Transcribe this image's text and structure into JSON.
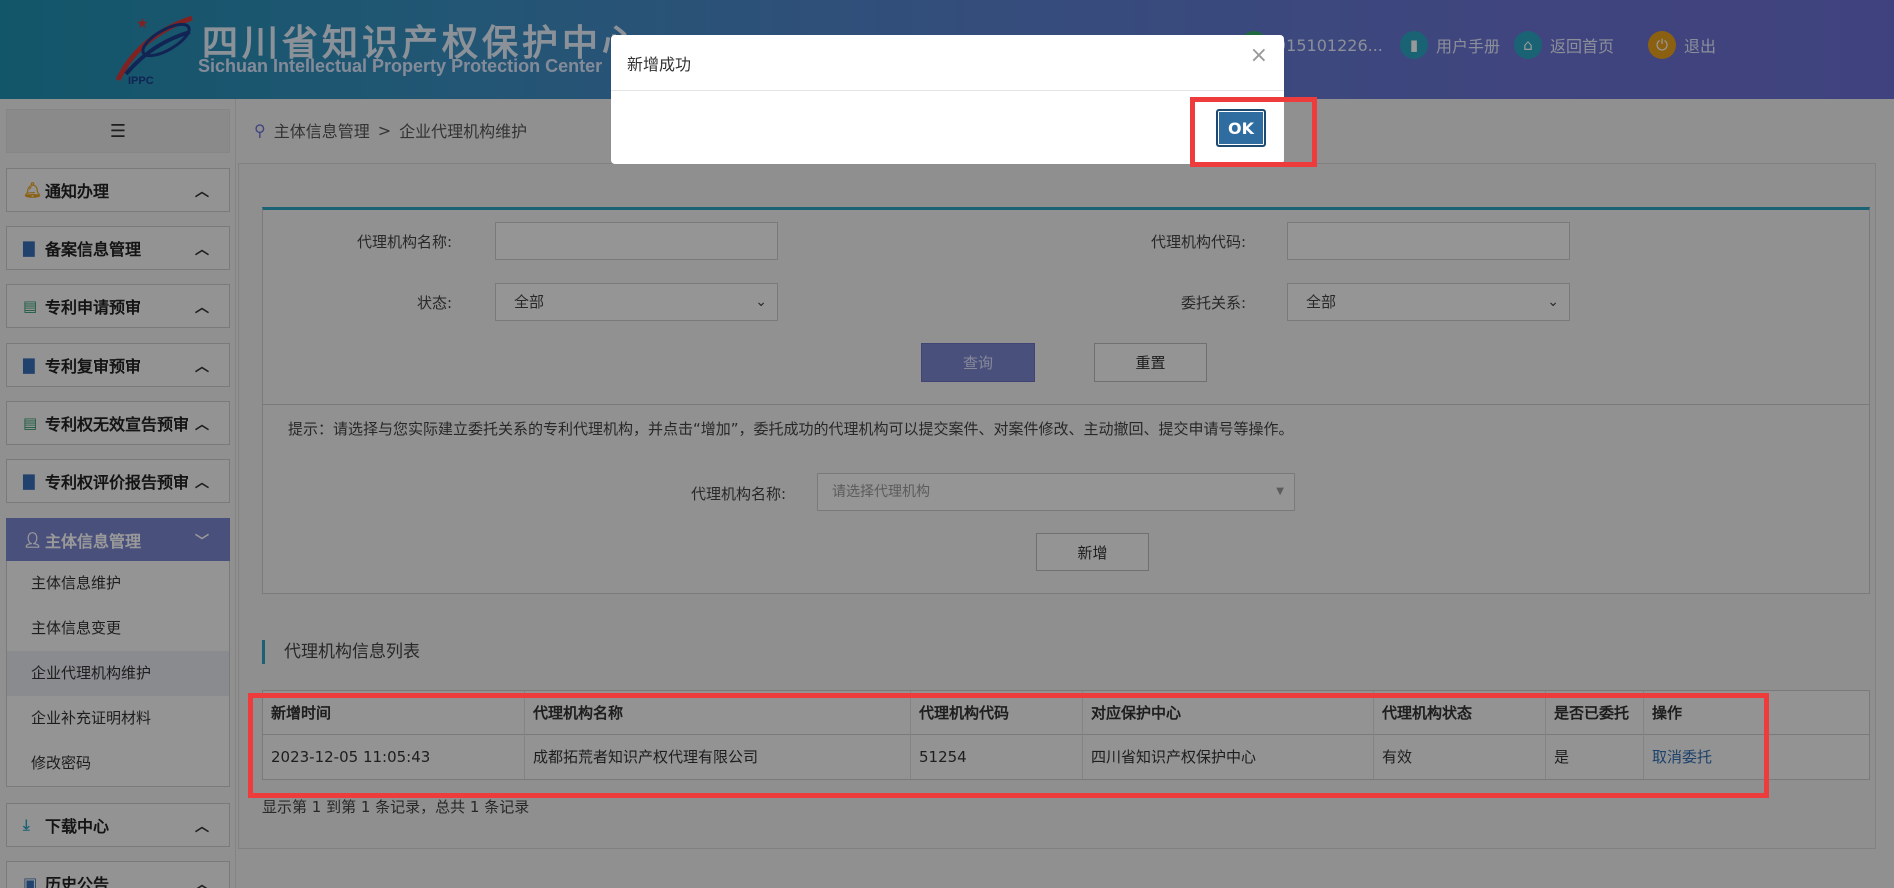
{
  "header": {
    "brand_cn": "四川省知识产权保护中心",
    "brand_en": "Sichuan Intellectual Property Protection Center",
    "logo_text": "IPPC",
    "account": "915101226...",
    "manual": "用户手册",
    "home": "返回首页",
    "logout": "退出"
  },
  "sidebar": {
    "groups": [
      {
        "label": "通知办理",
        "icon": "bell-icon"
      },
      {
        "label": "备案信息管理",
        "icon": "folder-icon"
      },
      {
        "label": "专利申请预审",
        "icon": "document-icon"
      },
      {
        "label": "专利复审预审",
        "icon": "folder-icon"
      },
      {
        "label": "专利权无效宣告预审",
        "icon": "document-icon"
      },
      {
        "label": "专利权评价报告预审",
        "icon": "folder-icon"
      },
      {
        "label": "主体信息管理",
        "icon": "user-icon"
      },
      {
        "label": "下载中心",
        "icon": "download-icon"
      },
      {
        "label": "历史公告",
        "icon": "announcement-icon"
      }
    ],
    "subitems": [
      "主体信息维护",
      "主体信息变更",
      "企业代理机构维护",
      "企业补充证明材料",
      "修改密码"
    ]
  },
  "breadcrumb": {
    "root": "主体信息管理",
    "sep": ">",
    "current": "企业代理机构维护"
  },
  "filter": {
    "name_label": "代理机构名称:",
    "code_label": "代理机构代码:",
    "status_label": "状态:",
    "status_value": "全部",
    "relation_label": "委托关系:",
    "relation_value": "全部",
    "query_button": "查询",
    "reset_button": "重置",
    "tip": "提示：请选择与您实际建立委托关系的专利代理机构，并点击“增加”，委托成功的代理机构可以提交案件、对案件修改、主动撤回、提交申请号等操作。",
    "agency_label": "代理机构名称:",
    "agency_placeholder": "请选择代理机构",
    "add_button": "新增"
  },
  "list": {
    "title": "代理机构信息列表",
    "columns": [
      "新增时间",
      "代理机构名称",
      "代理机构代码",
      "对应保护中心",
      "代理机构状态",
      "是否已委托",
      "操作"
    ],
    "rows": [
      [
        "2023-12-05 11:05:43",
        "成都拓荒者知识产权代理有限公司",
        "51254",
        "四川省知识产权保护中心",
        "有效",
        "是",
        "取消委托"
      ]
    ],
    "summary": "显示第 1 到第 1 条记录，总共 1 条记录"
  },
  "modal": {
    "title": "新增成功",
    "close": "×",
    "ok": "OK"
  },
  "colors": {
    "accent": "#7b86cf",
    "teal": "#2aa6c4",
    "highlight": "#ee3b3b",
    "ok": "#2f6ca0"
  }
}
